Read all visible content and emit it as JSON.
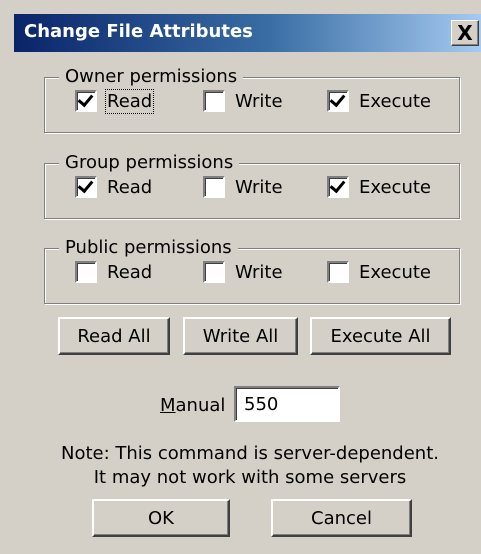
{
  "window": {
    "title": "Change File Attributes",
    "close_glyph": "X"
  },
  "groups": [
    {
      "legend": "Owner permissions",
      "items": [
        {
          "label": "Read",
          "checked": true,
          "focused": true
        },
        {
          "label": "Write",
          "checked": false
        },
        {
          "label": "Execute",
          "checked": true
        }
      ]
    },
    {
      "legend": "Group permissions",
      "items": [
        {
          "label": "Read",
          "checked": true
        },
        {
          "label": "Write",
          "checked": false
        },
        {
          "label": "Execute",
          "checked": true
        }
      ]
    },
    {
      "legend": "Public permissions",
      "items": [
        {
          "label": "Read",
          "checked": false
        },
        {
          "label": "Write",
          "checked": false
        },
        {
          "label": "Execute",
          "checked": false
        }
      ]
    }
  ],
  "buttons": {
    "read_all": "Read All",
    "write_all": "Write All",
    "execute_all": "Execute All",
    "ok": "OK",
    "cancel": "Cancel"
  },
  "manual": {
    "mnemonic": "M",
    "label_rest": "anual",
    "value": "550"
  },
  "note": {
    "line1": "Note: This command is server-dependent.",
    "line2": "It may not work with some servers"
  },
  "colors": {
    "title_gradient_start": "#0a246a",
    "title_gradient_end": "#a6caf0",
    "face": "#d4d0c8"
  }
}
